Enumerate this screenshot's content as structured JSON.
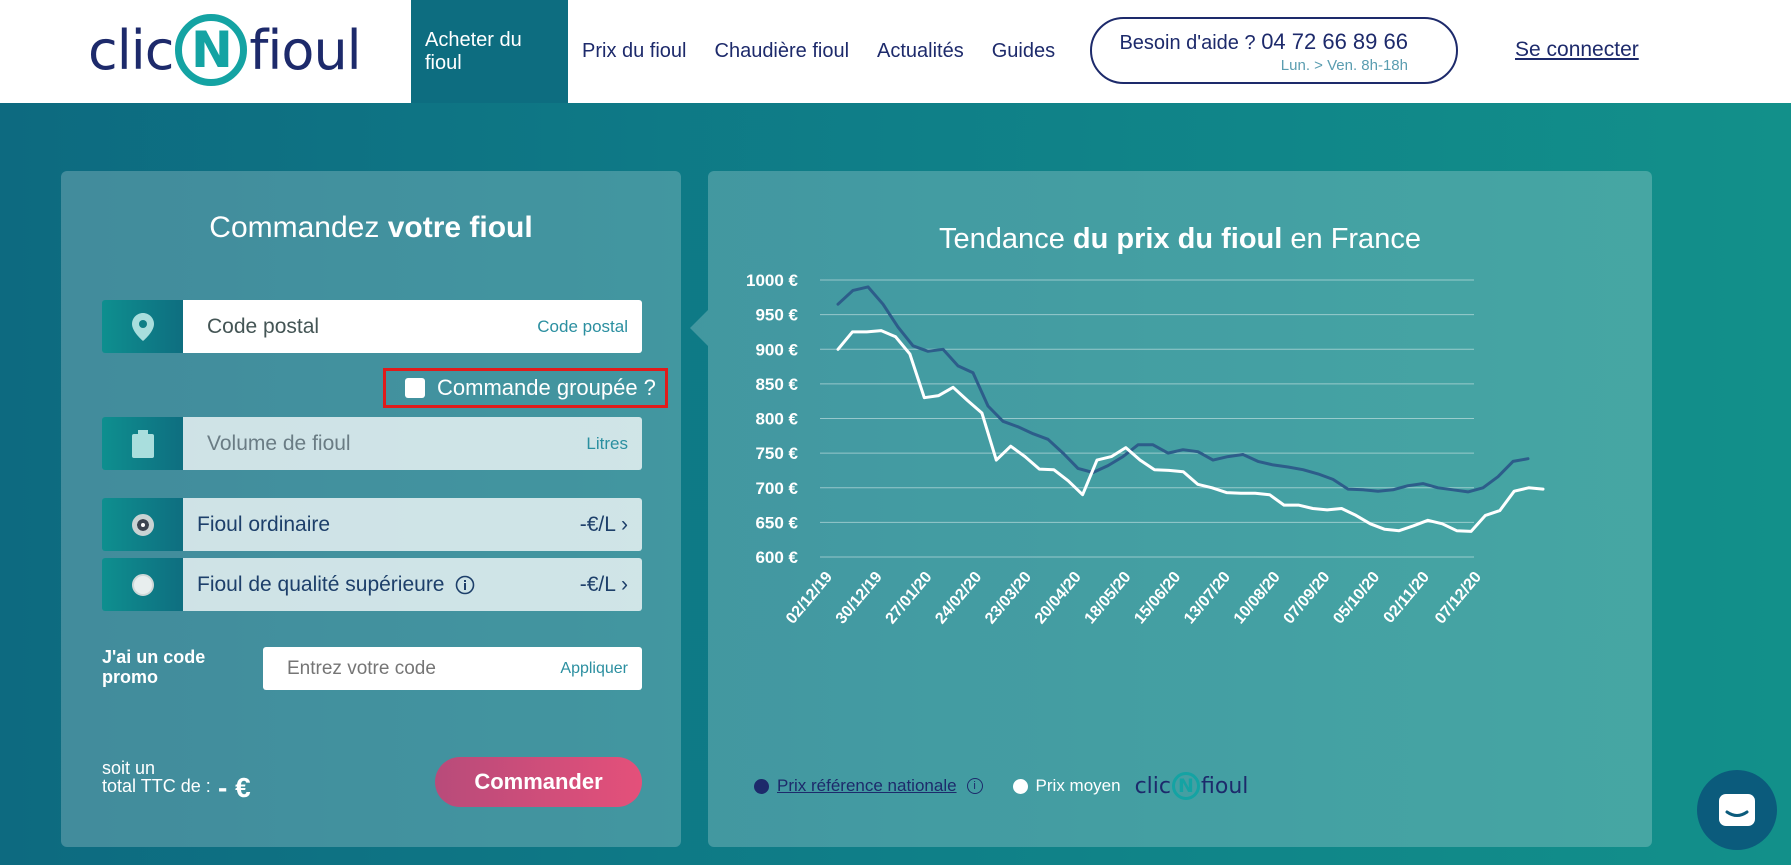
{
  "logo": {
    "left": "clic",
    "middle": "N",
    "right": "fioul"
  },
  "nav": {
    "items": [
      {
        "label": "Acheter du fioul",
        "active": true
      },
      {
        "label": "Prix du fioul"
      },
      {
        "label": "Chaudière fioul"
      },
      {
        "label": "Actualités"
      },
      {
        "label": "Guides"
      }
    ]
  },
  "help": {
    "text": "Besoin d'aide ?",
    "phone": "04 72 66 89 66",
    "hours": "Lun. > Ven. 8h-18h"
  },
  "login": "Se connecter",
  "order": {
    "title_plain": "Commandez",
    "title_bold": "votre fioul",
    "postal_label": "Code postal",
    "postal_unit": "Code postal",
    "group_label": "Commande groupée ?",
    "volume_label": "Volume de fioul",
    "volume_unit": "Litres",
    "fuel_ordinary": "Fioul ordinaire",
    "fuel_ordinary_price": "-€/L",
    "fuel_superior": "Fioul de qualité supérieure",
    "fuel_superior_price": "-€/L",
    "promo_label": "J'ai un code promo",
    "promo_placeholder": "Entrez votre code",
    "promo_apply": "Appliquer",
    "total_line1": "soit un",
    "total_line2": "total TTC de :",
    "total_value": "- €",
    "order_button": "Commander"
  },
  "chart": {
    "title_plain1": "Tendance",
    "title_bold": "du prix du fioul",
    "title_plain2": "en France",
    "legend_ref": "Prix référence nationale",
    "legend_avg": "Prix moyen"
  },
  "chart_data": {
    "type": "line",
    "x": [
      "02/12/19",
      "30/12/19",
      "27/01/20",
      "24/02/20",
      "23/03/20",
      "20/04/20",
      "18/05/20",
      "15/06/20",
      "13/07/20",
      "10/08/20",
      "07/09/20",
      "05/10/20",
      "02/11/20",
      "07/12/20"
    ],
    "ylim": [
      600,
      1000
    ],
    "yticks": [
      "1000 €",
      "950 €",
      "900 €",
      "850 €",
      "800 €",
      "750 €",
      "700 €",
      "650 €",
      "600 €"
    ],
    "series": [
      {
        "name": "Prix référence nationale",
        "color": "#2d5d8a",
        "values": [
          965,
          985,
          990,
          965,
          932,
          905,
          897,
          900,
          876,
          866,
          818,
          796,
          788,
          778,
          770,
          750,
          728,
          722,
          732,
          745,
          762,
          762,
          750,
          755,
          752,
          740,
          745,
          748,
          738,
          733,
          730,
          726,
          720,
          712,
          698,
          697,
          695,
          697,
          703,
          706,
          700,
          697,
          694,
          700,
          716,
          738,
          742
        ]
      },
      {
        "name": "Prix moyen",
        "color": "#ffffff",
        "values": [
          900,
          925,
          925,
          927,
          918,
          893,
          830,
          833,
          845,
          826,
          808,
          740,
          760,
          745,
          727,
          726,
          710,
          690,
          740,
          745,
          758,
          740,
          726,
          725,
          723,
          705,
          700,
          693,
          692,
          692,
          690,
          675,
          675,
          670,
          668,
          670,
          660,
          648,
          640,
          638,
          645,
          653,
          648,
          638,
          637,
          660,
          667,
          695,
          700,
          698
        ]
      }
    ]
  }
}
